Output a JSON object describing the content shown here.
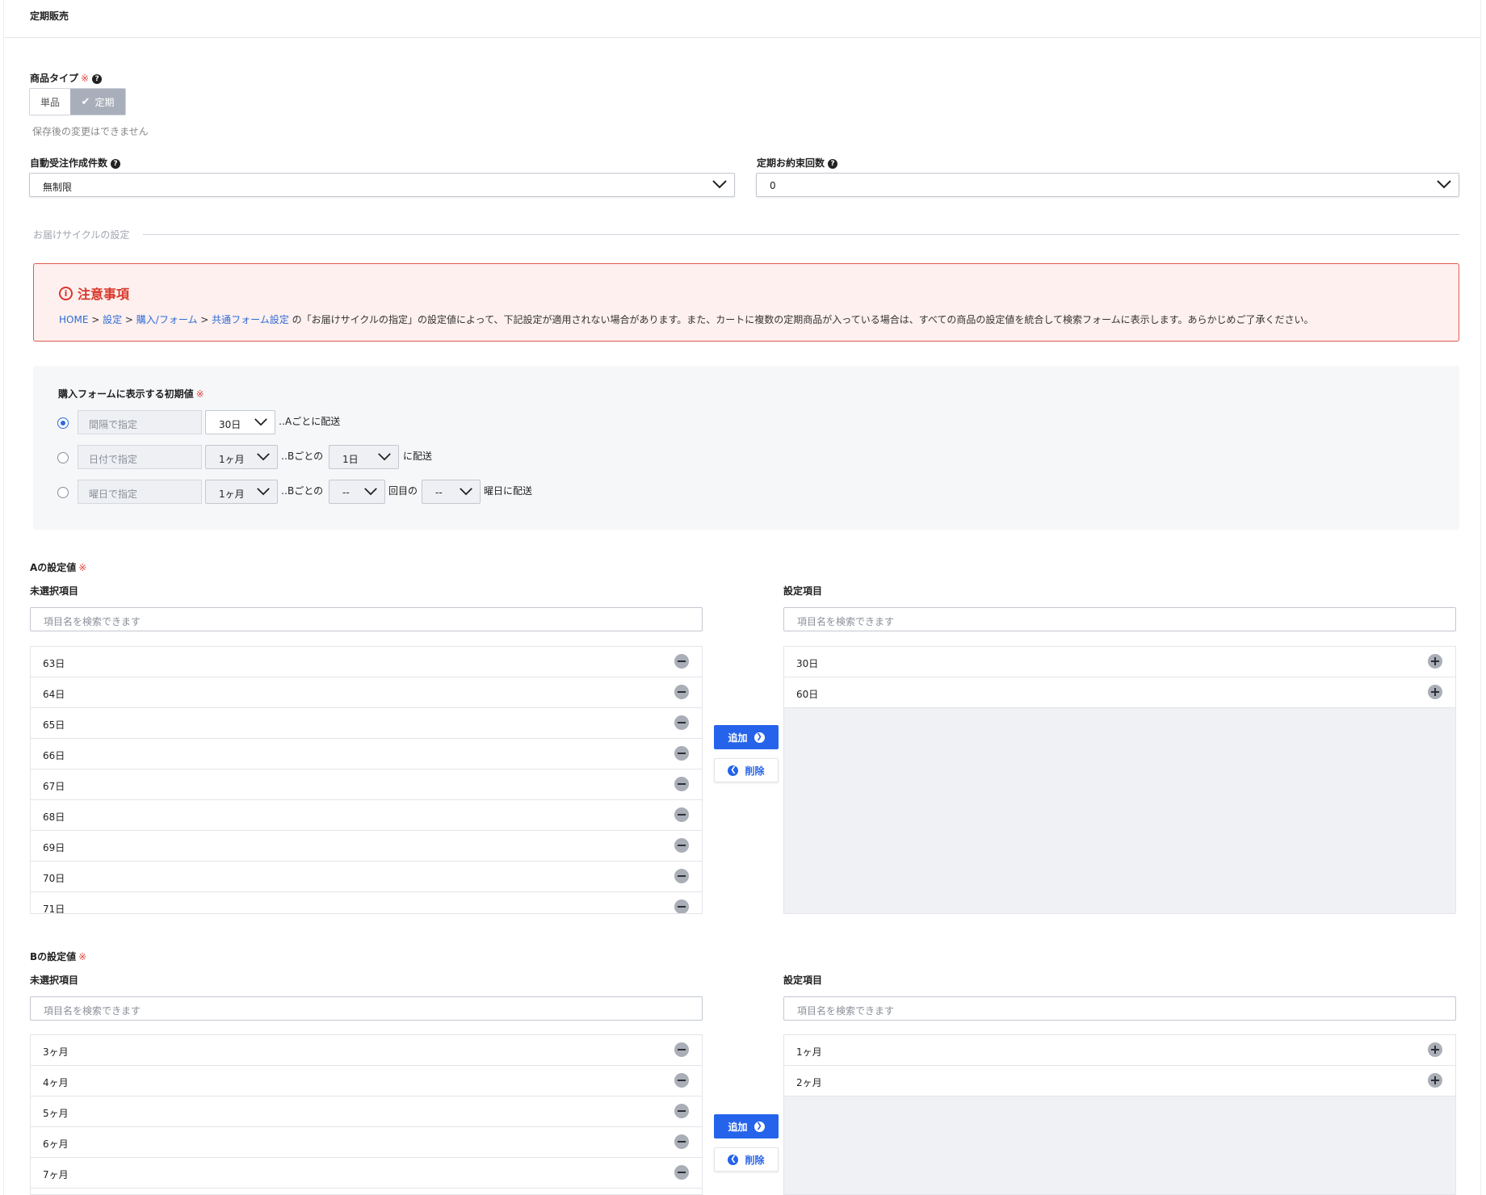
{
  "header": {
    "title": "定期販売"
  },
  "product_type": {
    "label": "商品タイプ",
    "required_mark": "※",
    "options": [
      "単品",
      "定期"
    ],
    "selected": "定期",
    "hint": "保存後の変更はできません"
  },
  "auto_order": {
    "label": "自動受注作成件数",
    "value": "無制限"
  },
  "promise_count": {
    "label": "定期お約束回数",
    "value": "0"
  },
  "cycle_section": {
    "label": "お届けサイクルの設定"
  },
  "notice": {
    "title": "注意事項",
    "links": [
      "HOME",
      "設定",
      "購入/フォーム",
      "共通フォーム設定"
    ],
    "separator": " > ",
    "body": " の「お届けサイクルの指定」の設定値によって、下記設定が適用されない場合があります。また、カートに複数の定期商品が入っている場合は、すべての商品の設定値を統合して検索フォームに表示します。あらかじめご了承ください。"
  },
  "defaults": {
    "label": "購入フォームに表示する初期値",
    "required_mark": "※",
    "row1": {
      "input": "間隔で指定",
      "select": "30日",
      "suffix": "‥Aごとに配送"
    },
    "row2": {
      "input": "日付で指定",
      "select1": "1ヶ月",
      "mid": "‥Bごとの",
      "select2": "1日",
      "suffix": "に配送"
    },
    "row3": {
      "input": "曜日で指定",
      "select1": "1ヶ月",
      "mid": "‥Bごとの",
      "select2": "--",
      "mid2": "回目の",
      "select3": "--",
      "suffix": "曜日に配送"
    }
  },
  "a_setting": {
    "label": "Aの設定値",
    "required_mark": "※",
    "unselected_label": "未選択項目",
    "selected_label": "設定項目",
    "search_placeholder": "項目名を検索できます",
    "unselected": [
      "63日",
      "64日",
      "65日",
      "66日",
      "67日",
      "68日",
      "69日",
      "70日",
      "71日"
    ],
    "selected": [
      "30日",
      "60日"
    ],
    "add_label": "追加",
    "delete_label": "削除"
  },
  "b_setting": {
    "label": "Bの設定値",
    "required_mark": "※",
    "unselected_label": "未選択項目",
    "selected_label": "設定項目",
    "search_placeholder": "項目名を検索できます",
    "unselected": [
      "3ヶ月",
      "4ヶ月",
      "5ヶ月",
      "6ヶ月",
      "7ヶ月"
    ],
    "selected": [
      "1ヶ月",
      "2ヶ月"
    ],
    "add_label": "追加",
    "delete_label": "削除"
  }
}
